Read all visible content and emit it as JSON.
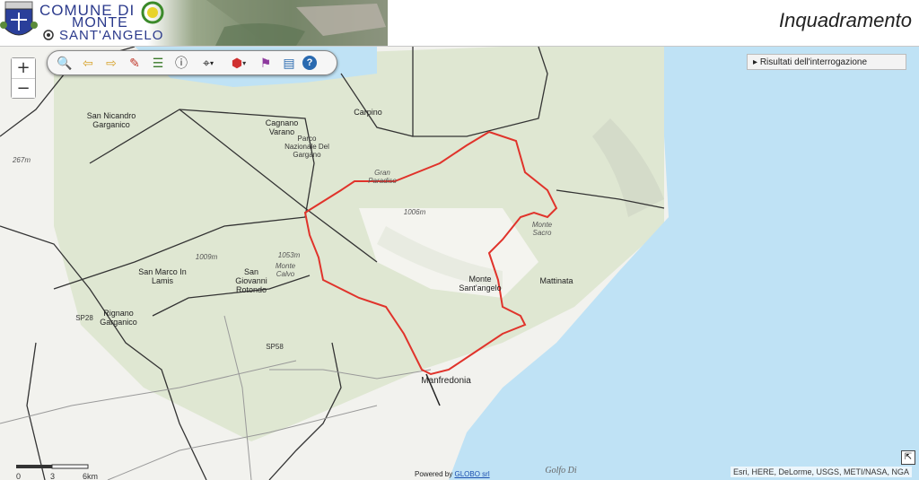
{
  "header": {
    "logo_line1": "COMUNE DI",
    "logo_line2": "MONTE",
    "logo_line3": "SANT'ANGELO",
    "title": "Inquadramento"
  },
  "zoom": {
    "in_label": "+",
    "out_label": "−"
  },
  "toolbar": {
    "tools": [
      {
        "name": "zoom-extent-icon",
        "glyph": "🔍"
      },
      {
        "name": "back-arrow-icon",
        "glyph": "⇦"
      },
      {
        "name": "forward-arrow-icon",
        "glyph": "⇨"
      },
      {
        "name": "eraser-icon",
        "glyph": "✎"
      },
      {
        "name": "legend-icon",
        "glyph": "☰"
      },
      {
        "name": "info-icon",
        "glyph": "ⓘ"
      },
      {
        "name": "binoculars-icon",
        "glyph": "⌖"
      },
      {
        "name": "layers-icon",
        "glyph": "⬢"
      },
      {
        "name": "measure-icon",
        "glyph": "⚑"
      },
      {
        "name": "basemap-icon",
        "glyph": "▤"
      },
      {
        "name": "help-icon",
        "glyph": "?"
      }
    ]
  },
  "results_panel": {
    "label": "Risultati dell'interrogazione"
  },
  "map_labels": {
    "san_nicandro": "San Nicandro Garganico",
    "cagnano": "Cagnano Varano",
    "carpino": "Carpino",
    "parco": "Parco Nazionale Del Gargano",
    "gran_paradiso": "Gran Paradiso",
    "elev_1006": "1006m",
    "elev_267": "267m",
    "elev_1053": "1053m",
    "elev_1009": "1009m",
    "monte_calvo": "Monte Calvo",
    "monte_sacro": "Monte Sacro",
    "san_marco": "San Marco In Lamis",
    "san_giovanni": "San Giovanni Rotondo",
    "monte_santangelo": "Monte Sant'angelo",
    "mattinata": "Mattinata",
    "rignano": "Rignano Garganico",
    "manfredonia": "Manfredonia",
    "golfo": "Golfo Di",
    "sp28": "SP28",
    "sp58": "SP58"
  },
  "scale": {
    "labels": [
      "0",
      "3",
      "6km"
    ]
  },
  "powered_by": {
    "prefix": "Powered by",
    "link": "GLOBO srl"
  },
  "attribution": "Esri, HERE, DeLorme, USGS, METI/NASA, NGA",
  "colors": {
    "sea": "#bfe2f5",
    "land": "#dfe6d4",
    "boundary": "#e0332b"
  }
}
